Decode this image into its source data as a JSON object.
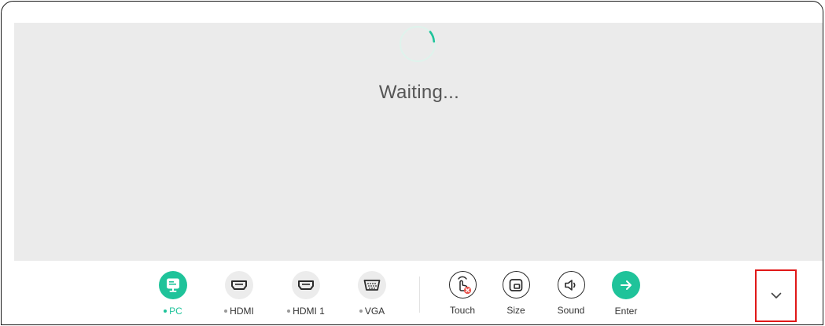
{
  "preview": {
    "status_text": "Waiting..."
  },
  "sources": [
    {
      "label": "PC",
      "icon": "monitor-icon",
      "active": true
    },
    {
      "label": "HDMI",
      "icon": "hdmi-port-icon",
      "active": false
    },
    {
      "label": "HDMI 1",
      "icon": "hdmi-port-icon",
      "active": false
    },
    {
      "label": "VGA",
      "icon": "vga-port-icon",
      "active": false
    }
  ],
  "actions": [
    {
      "label": "Touch",
      "icon": "touch-disabled-icon"
    },
    {
      "label": "Size",
      "icon": "screen-size-icon"
    },
    {
      "label": "Sound",
      "icon": "speaker-icon"
    },
    {
      "label": "Enter",
      "icon": "arrow-right-icon"
    }
  ],
  "collapse": {
    "icon": "chevron-down-icon"
  },
  "colors": {
    "accent": "#1fc39a",
    "preview_background": "#ebebeb",
    "highlight_box": "#e01818",
    "error_badge": "#e8554e"
  }
}
